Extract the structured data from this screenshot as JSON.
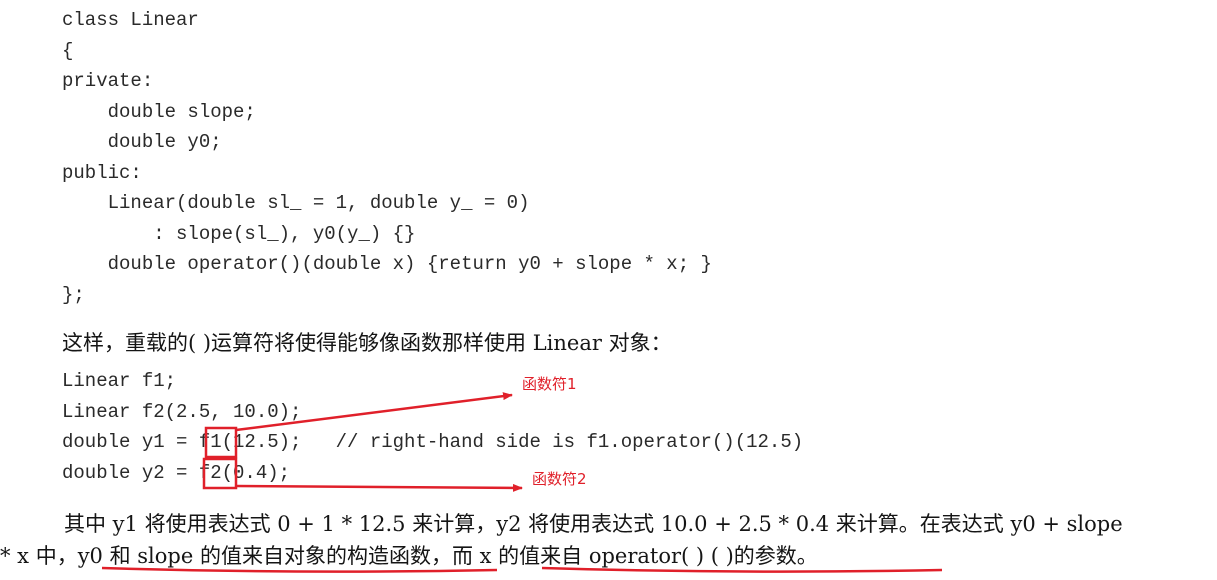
{
  "code_block_1": [
    "class Linear",
    "{",
    "private:",
    "    double slope;",
    "    double y0;",
    "public:",
    "    Linear(double sl_ = 1, double y_ = 0)",
    "        : slope(sl_), y0(y_) {}",
    "    double operator()(double x) {return y0 + slope * x; }",
    "};"
  ],
  "prose_1": "这样，重载的( )运算符将使得能够像函数那样使用 Linear 对象：",
  "code_block_2": [
    "Linear f1;",
    "Linear f2(2.5, 10.0);",
    "double y1 = f1(12.5);   // right-hand side is f1.operator()(12.5)",
    "double y2 = f2(0.4);"
  ],
  "prose_2": "其中 y1 将使用表达式 0 + 1 * 12.5 来计算，y2 将使用表达式 10.0 + 2.5 * 0.4 来计算。在表达式 y0 + slope",
  "prose_3": "* x 中，y0 和 slope 的值来自对象的构造函数，而 x 的值来自 operator( ) ( )的参数。",
  "annotations": {
    "label_1": "函数符1",
    "label_2": "函数符2",
    "color": "#e0202a"
  }
}
